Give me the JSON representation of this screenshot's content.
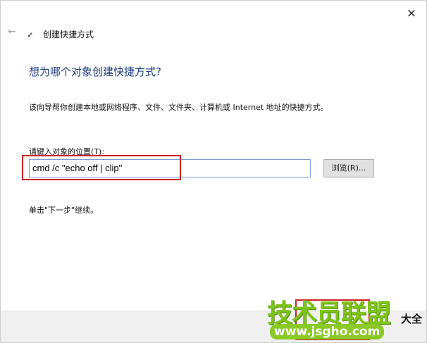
{
  "window": {
    "title": "创建快捷方式",
    "close_glyph": "×",
    "back_glyph": "←"
  },
  "main": {
    "heading": "想为哪个对象创建快捷方式?",
    "description": "该向导帮你创建本地或网络程序、文件、文件夹、计算机或 Internet 地址的快捷方式。",
    "field_label_prefix": "请键入对象的位置(",
    "field_label_accesskey": "T",
    "field_label_suffix": "):",
    "location_value": "cmd /c \"echo off | clip\"",
    "browse_label": "浏览(R)...",
    "hint": "单击\"下一步\"继续。"
  },
  "watermark": {
    "main": "技术员联盟",
    "url": "www.jsgho.com",
    "side": "大全"
  },
  "colors": {
    "heading": "#1f3d80",
    "highlight": "#cc2222",
    "watermark_green": "#7fc31a"
  },
  "icons": [
    "close-icon",
    "back-arrow-icon",
    "wizard-icon"
  ]
}
